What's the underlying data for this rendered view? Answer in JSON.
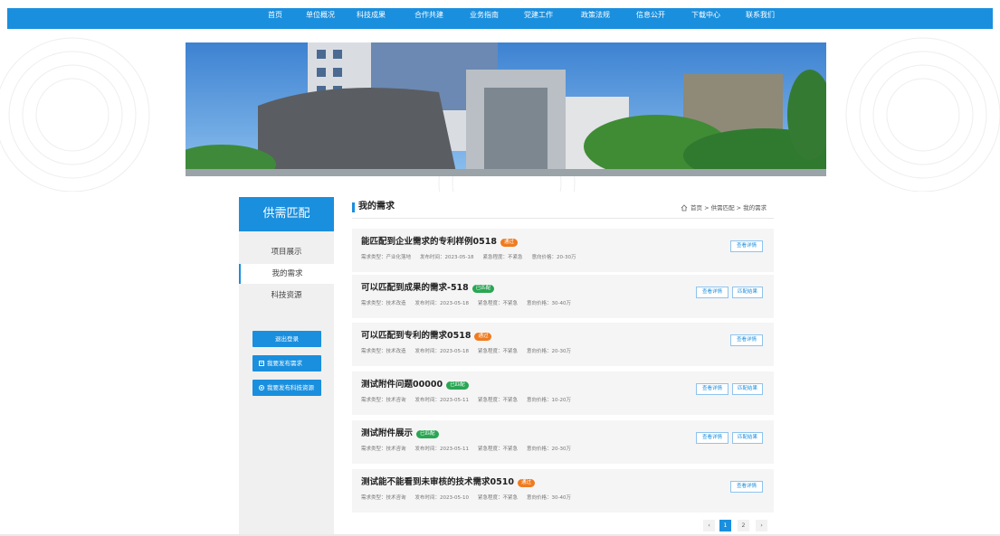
{
  "colors": {
    "primary": "#1a8fde",
    "badge_orange": "#f07b1f",
    "badge_green": "#2aa653"
  },
  "nav": [
    "首页",
    "单位概况",
    "科技成果",
    "合作共建",
    "业务指南",
    "党建工作",
    "政策法规",
    "信息公开",
    "下载中心",
    "联系我们"
  ],
  "sidebar": {
    "title": "供需匹配",
    "items": [
      "项目展示",
      "我的需求",
      "科技资源"
    ],
    "active_index": 1,
    "buttons": {
      "logout": "退出登录",
      "publish_demand": "我要发布需求",
      "publish_resource": "我要发布科技资源"
    }
  },
  "main": {
    "title": "我的需求",
    "breadcrumb": "首页 > 供需匹配 > 我的需求",
    "detail_label": "查看详情",
    "match_label": "匹配结果",
    "cards": [
      {
        "title": "能匹配到企业需求的专利样例0518",
        "badge": "通过",
        "badge_color": "#f07b1f",
        "type": "需求类型：产业化落地",
        "date": "发布时间：2023-05-18",
        "urgency": "紧急程度：不紧急",
        "price": "意向价格：20-30万",
        "has_match": false
      },
      {
        "title": "可以匹配到成果的需求-518",
        "badge": "已匹配",
        "badge_color": "#2aa653",
        "type": "需求类型：技术改造",
        "date": "发布时间：2023-05-18",
        "urgency": "紧急程度：不紧急",
        "price": "意向价格：30-40万",
        "has_match": true
      },
      {
        "title": "可以匹配到专利的需求0518",
        "badge": "通过",
        "badge_color": "#f07b1f",
        "type": "需求类型：技术改造",
        "date": "发布时间：2023-05-18",
        "urgency": "紧急程度：不紧急",
        "price": "意向价格：20-30万",
        "has_match": false
      },
      {
        "title": "测试附件问题00000",
        "badge": "已匹配",
        "badge_color": "#2aa653",
        "type": "需求类型：技术咨询",
        "date": "发布时间：2023-05-11",
        "urgency": "紧急程度：不紧急",
        "price": "意向价格：10-20万",
        "has_match": true
      },
      {
        "title": "测试附件展示",
        "badge": "已匹配",
        "badge_color": "#2aa653",
        "type": "需求类型：技术咨询",
        "date": "发布时间：2023-05-11",
        "urgency": "紧急程度：不紧急",
        "price": "意向价格：20-30万",
        "has_match": true
      },
      {
        "title": "测试能不能看到未审核的技术需求0510",
        "badge": "通过",
        "badge_color": "#f07b1f",
        "type": "需求类型：技术咨询",
        "date": "发布时间：2023-05-10",
        "urgency": "紧急程度：不紧急",
        "price": "意向价格：30-40万",
        "has_match": false
      }
    ]
  },
  "pagination": {
    "prev": "‹",
    "pages": [
      "1",
      "2"
    ],
    "current": "1",
    "next": "›"
  }
}
